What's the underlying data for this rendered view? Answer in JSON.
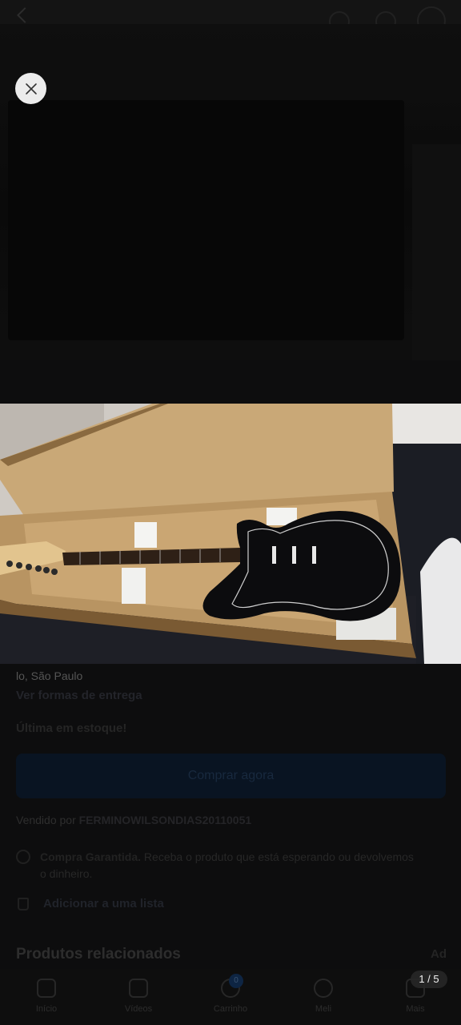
{
  "underlying_page": {
    "location_text": "lo, São Paulo",
    "shipping_link": "Ver formas de entrega",
    "stock_text": "Última em estoque!",
    "buy_button": "Comprar agora",
    "seller_prefix": "Vendido por",
    "seller_name": "FERMINOWILSONDIAS20110051",
    "guarantee_title": "Compra Garantida.",
    "guarantee_text": "Receba o produto que está esperando ou devolvemos o dinheiro.",
    "add_to_list": "Adicionar a uma lista",
    "related_title": "Produtos relacionados",
    "related_link": "Ad"
  },
  "bottom_nav": {
    "items": [
      {
        "label": "Início",
        "icon": "home-icon"
      },
      {
        "label": "Vídeos",
        "icon": "video-icon"
      },
      {
        "label": "Carrinho",
        "icon": "cart-icon"
      },
      {
        "label": "Meli",
        "icon": "sparkle-icon"
      },
      {
        "label": "Mais",
        "icon": "menu-icon"
      }
    ],
    "cart_badge": "0"
  },
  "viewer": {
    "close_icon": "close-icon",
    "photo_subject": "black electric guitar in open cardboard box",
    "counter": "1 / 5"
  },
  "colors": {
    "overlay_bg": "#0b0b0c",
    "close_button_bg": "#ececec",
    "counter_bg": "#282828",
    "guitar_body": "#0c0c0e",
    "box_cardboard": "#c9a877"
  }
}
